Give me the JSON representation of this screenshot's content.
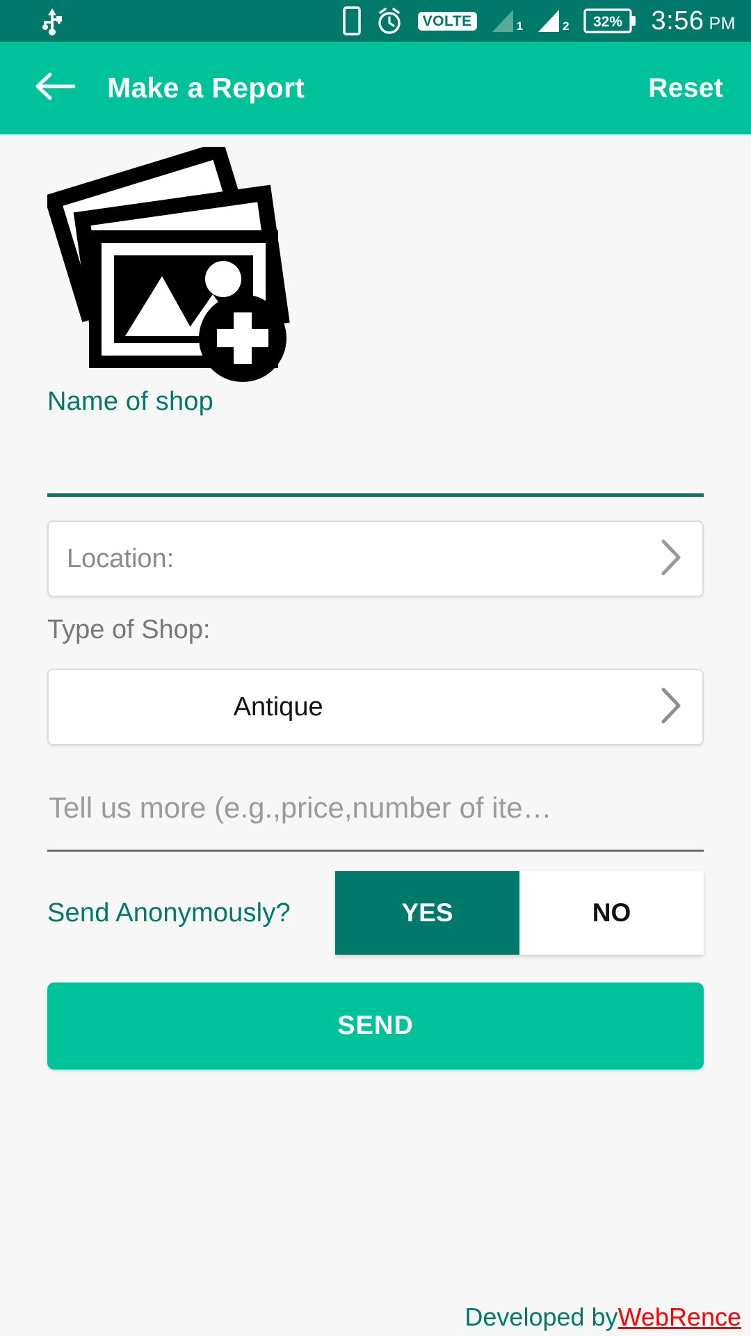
{
  "statusbar": {
    "icons": [
      "usb-icon",
      "phone-icon",
      "alarm-icon",
      "volte-badge",
      "signal-1-icon",
      "signal-2-icon",
      "battery-icon"
    ],
    "volte_label": "VOLTE",
    "sim1_label": "1",
    "sim2_label": "2",
    "battery_percent": "32%",
    "time": "3:56",
    "ampm": "PM"
  },
  "appbar": {
    "back_icon": "arrow-left-icon",
    "title": "Make a Report",
    "reset_label": "Reset"
  },
  "form": {
    "photo_icon": "add-photo-icon",
    "shop_name": {
      "label": "Name of shop",
      "value": "",
      "placeholder": ""
    },
    "location": {
      "placeholder": "Location:",
      "value": "",
      "chevron": "chevron-right-icon"
    },
    "type_of_shop": {
      "label": "Type of Shop:",
      "value": "Antique",
      "chevron": "chevron-right-icon"
    },
    "details": {
      "placeholder": "Tell us more (e.g.,price,number of ite…",
      "value": ""
    },
    "anonymous": {
      "label": "Send Anonymously?",
      "yes_label": "YES",
      "no_label": "NO",
      "selected": "YES"
    },
    "send_label": "SEND"
  },
  "footer": {
    "prefix": "Developed by ",
    "brand": "WebRence"
  },
  "colors": {
    "status_bar": "#00796b",
    "app_bar": "#00c29a",
    "accent_teal": "#00796b",
    "primary_green": "#00c29a",
    "page_bg": "#f7f7f7",
    "brand_red": "#ff0000"
  }
}
